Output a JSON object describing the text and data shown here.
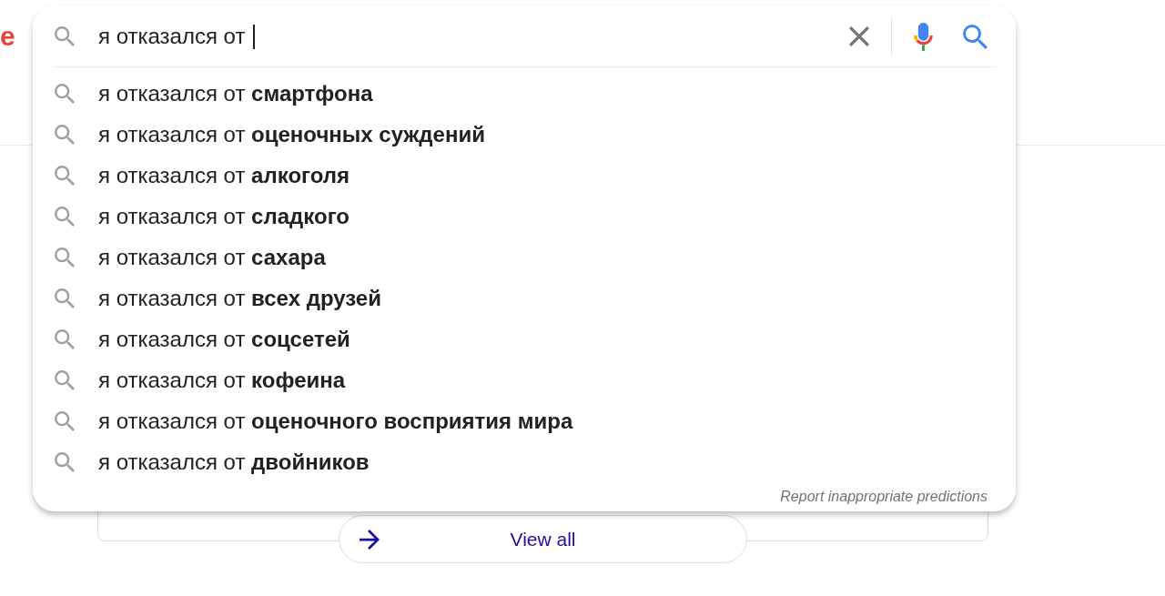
{
  "logo": {
    "text": "e"
  },
  "search": {
    "value": "я отказался от",
    "focused": true
  },
  "suggestions": [
    {
      "text": "я отказался от **смартфона**"
    },
    {
      "text": "я отказался от **оценочных суждений**"
    },
    {
      "text": "я отказался от **алкоголя**"
    },
    {
      "text": "я отказался от **сладкого**"
    },
    {
      "text": "я отказался от **сахара**"
    },
    {
      "text": "я отказался от **всех друзей**"
    },
    {
      "text": "я отказался от **соцсетей**"
    },
    {
      "text": "я отказался от **кофеина**"
    },
    {
      "text": "я отказался от **оценочного восприятия мира**"
    },
    {
      "text": "я отказался от **двойников**"
    }
  ],
  "report_link": "Report inappropriate predictions",
  "view_all": {
    "label": "View all"
  }
}
